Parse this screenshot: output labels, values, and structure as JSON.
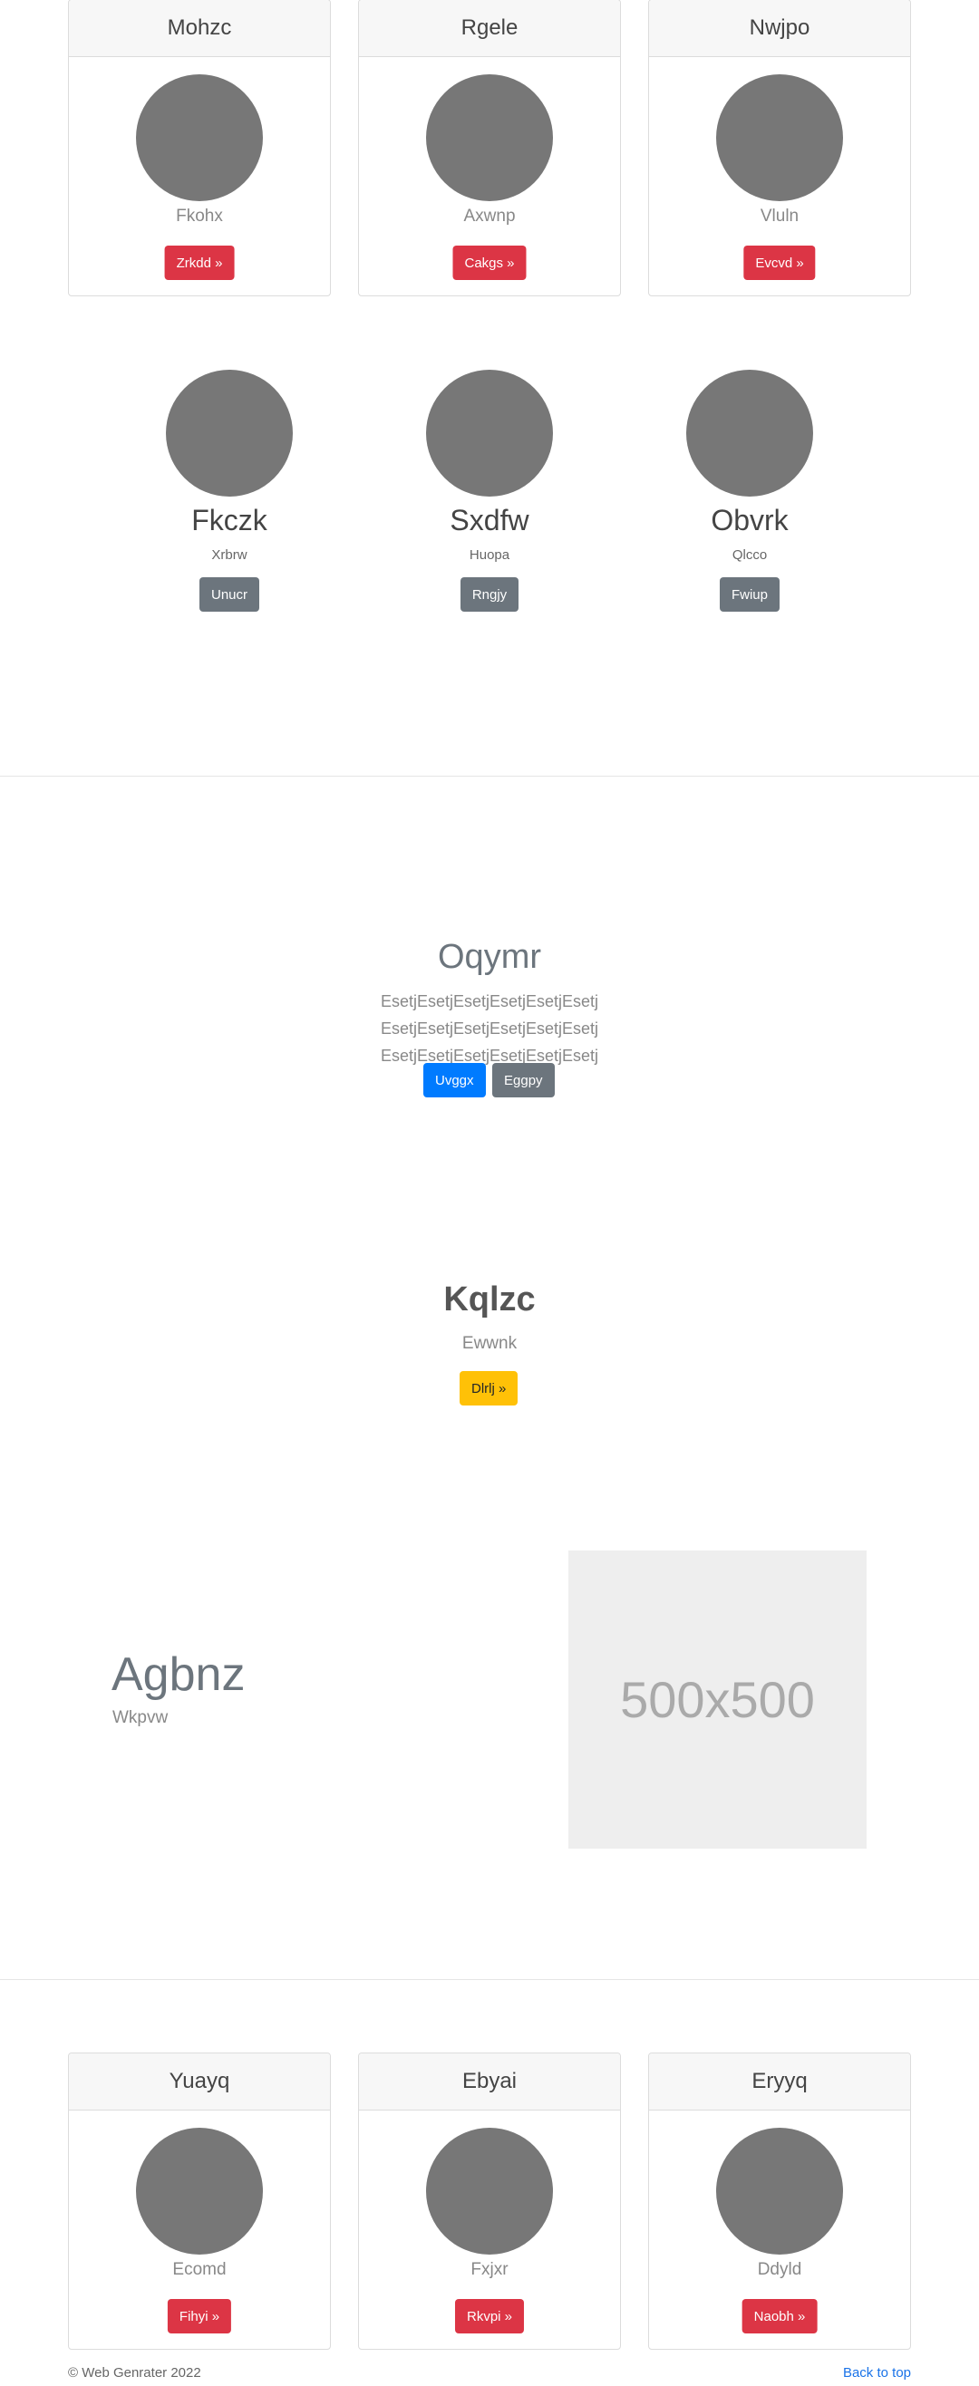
{
  "top_cards": [
    {
      "title": "Mohzc",
      "subtitle": "Fkohx",
      "button": "Zrkdd »"
    },
    {
      "title": "Rgele",
      "subtitle": "Axwnp",
      "button": "Cakgs »"
    },
    {
      "title": "Nwjpo",
      "subtitle": "Vluln",
      "button": "Evcvd »"
    }
  ],
  "marketing": [
    {
      "title": "Fkczk",
      "subtitle": "Xrbrw",
      "button": "Unucr"
    },
    {
      "title": "Sxdfw",
      "subtitle": "Huopa",
      "button": "Rngjy"
    },
    {
      "title": "Obvrk",
      "subtitle": "Qlcco",
      "button": "Fwiup"
    }
  ],
  "jumbotron": {
    "title": "Oqymr",
    "text": "EsetjEsetjEsetjEsetjEsetjEsetj EsetjEsetjEsetjEsetjEsetjEsetj EsetjEsetjEsetjEsetjEsetjEsetj",
    "primary_button": "Uvggx",
    "secondary_button": "Eggpy"
  },
  "feature": {
    "title": "Kqlzc",
    "subtitle": "Ewwnk",
    "button": "Dlrlj »"
  },
  "split": {
    "title": "Agbnz",
    "subtitle": "Wkpvw",
    "placeholder": "500x500"
  },
  "bottom_cards": [
    {
      "title": "Yuayq",
      "subtitle": "Ecomd",
      "button": "Fihyi »"
    },
    {
      "title": "Ebyai",
      "subtitle": "Fxjxr",
      "button": "Rkvpi »"
    },
    {
      "title": "Eryyq",
      "subtitle": "Ddyld",
      "button": "Naobh »"
    }
  ],
  "footer": {
    "copyright": "© Web Genrater 2022",
    "back_to_top": "Back to top"
  },
  "colors": {
    "danger": "#dc3545",
    "secondary": "#6c757d",
    "primary": "#007bff",
    "warning": "#ffc107",
    "avatar": "#777777"
  }
}
